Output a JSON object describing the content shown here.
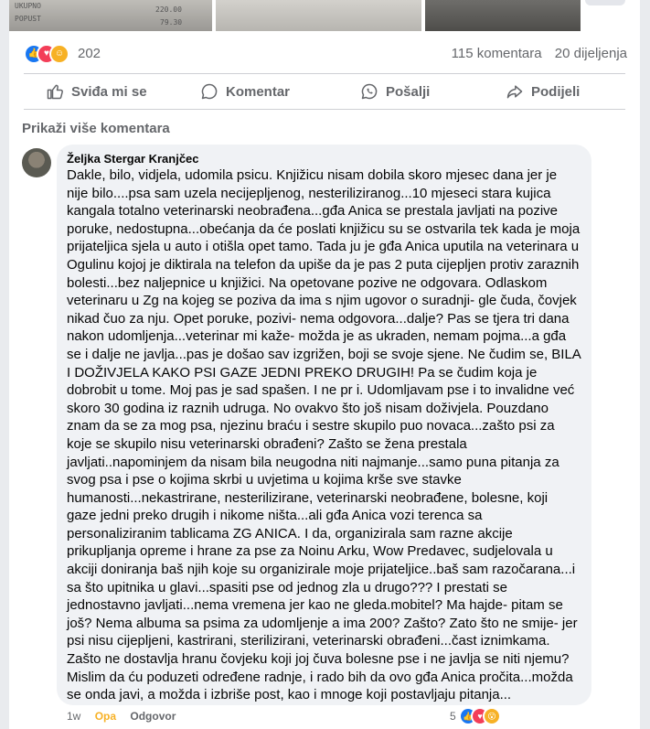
{
  "post": {
    "reactions": {
      "count": "202",
      "icons": [
        "like-icon",
        "love-icon",
        "care-icon"
      ],
      "colors": {
        "like": "#1877f2",
        "love": "#f33e58",
        "care": "#f7b125"
      }
    },
    "comments_label": "115 komentara",
    "shares_label": "20 dijeljenja",
    "actions": {
      "like": "Sviđa mi se",
      "comment": "Komentar",
      "send": "Pošalji",
      "share": "Podijeli"
    },
    "show_more_comments": "Prikaži više komentara",
    "image_text": {
      "receipt_line1": "UKUPNO",
      "receipt_line2": "POPUST",
      "receipt_num1": "220.00",
      "receipt_num2": "79.30"
    }
  },
  "comment": {
    "author": "Željka Stergar Kranjčec",
    "text": "Dakle, bilo, vidjela, udomila psicu. Knjižicu nisam dobila skoro mjesec dana jer je nije bilo....psa sam uzela necijepljenog, nesteriliziranog...10 mjeseci stara kujica kangala totalno veterinarski neobrađena...gđa Anica se prestala javljati na pozive poruke, nedostupna...obećanja da će poslati knjižicu su se ostvarila tek kada je moja prijateljica sjela u auto i otišla opet tamo. Tada ju je gđa Anica uputila na veterinara u Ogulinu kojoj je diktirala na telefon da upiše da je pas 2 puta cijepljen protiv zaraznih bolesti...bez naljepnice u knjižici. Na opetovane pozive ne odgovara. Odlaskom veterinaru u Zg na kojeg se poziva da ima s njim ugovor o suradnji- gle čuda, čovjek nikad čuo za nju. Opet poruke, pozivi- nema odgovora...dalje? Pas se tjera tri dana nakon udomljenja...veterinar mi kaže- možda je as ukraden, nemam pojma...a gđa se i dalje ne javlja...pas je došao sav izgrižen, boji se svoje sjene. Ne čudim se, BILA I DOŽIVJELA KAKO PSI GAZE JEDNI PREKO DRUGIH! Pa se čudim koja je dobrobit u tome. Moj pas je sad spašen. I ne pr i. Udomljavam pse i to invalidne već skoro 30 godina iz raznih udruga. No ovakvo što još nisam doživjela. Pouzdano znam da se za mog psa, njezinu braću i sestre skupilo puo novaca...zašto psi za koje se skupilo nisu veterinarski obrađeni? Zašto se žena prestala javljati..napominjem da nisam bila neugodna niti najmanje...samo puna pitanja za svog psa i pse o kojima skrbi u uvjetima u kojima krše sve stavke humanosti...nekastrirane, nesterilizirane, veterinarski neobrađene, bolesne, koji gaze jedni preko drugih i nikome ništa...ali gđa Anica vozi terenca sa personaliziranim tablicama ZG ANICA. I da, organizirala sam razne akcije prikupljanja opreme i hrane za pse za Noinu Arku, Wow Predavec, sudjelovala u akciji doniranja baš njih koje su organizirale moje prijateljice..baš sam razočarana...i sa što upitnika u glavi...spasiti pse od jednog zla u drugo??? I prestati se jednostavno javljati...nema vremena jer kao ne gleda.mobitel? Ma hajde- pitam se još? Nema albuma sa psima za udomljenje a ima 200? Zašto? Zato što ne smije- jer psi nisu cijepljeni, kastrirani, sterilizirani, veterinarski obrađeni...čast iznimkama. Zašto ne dostavlja hranu čovjeku koji joj čuva bolesne pse i ne javlja se niti njemu?\nMislim da ću poduzeti određene radnje, i rado bih da ovo gđa Anica pročita...možda se onda javi, a možda i izbriše post, kao i mnoge koji postavljaju pitanja...",
    "time": "1w",
    "reaction_label": "Opa",
    "reply_label": "Odgovor",
    "reaction_count": "5",
    "reaction_icons": [
      "like-icon",
      "love-icon",
      "wow-icon"
    ]
  }
}
